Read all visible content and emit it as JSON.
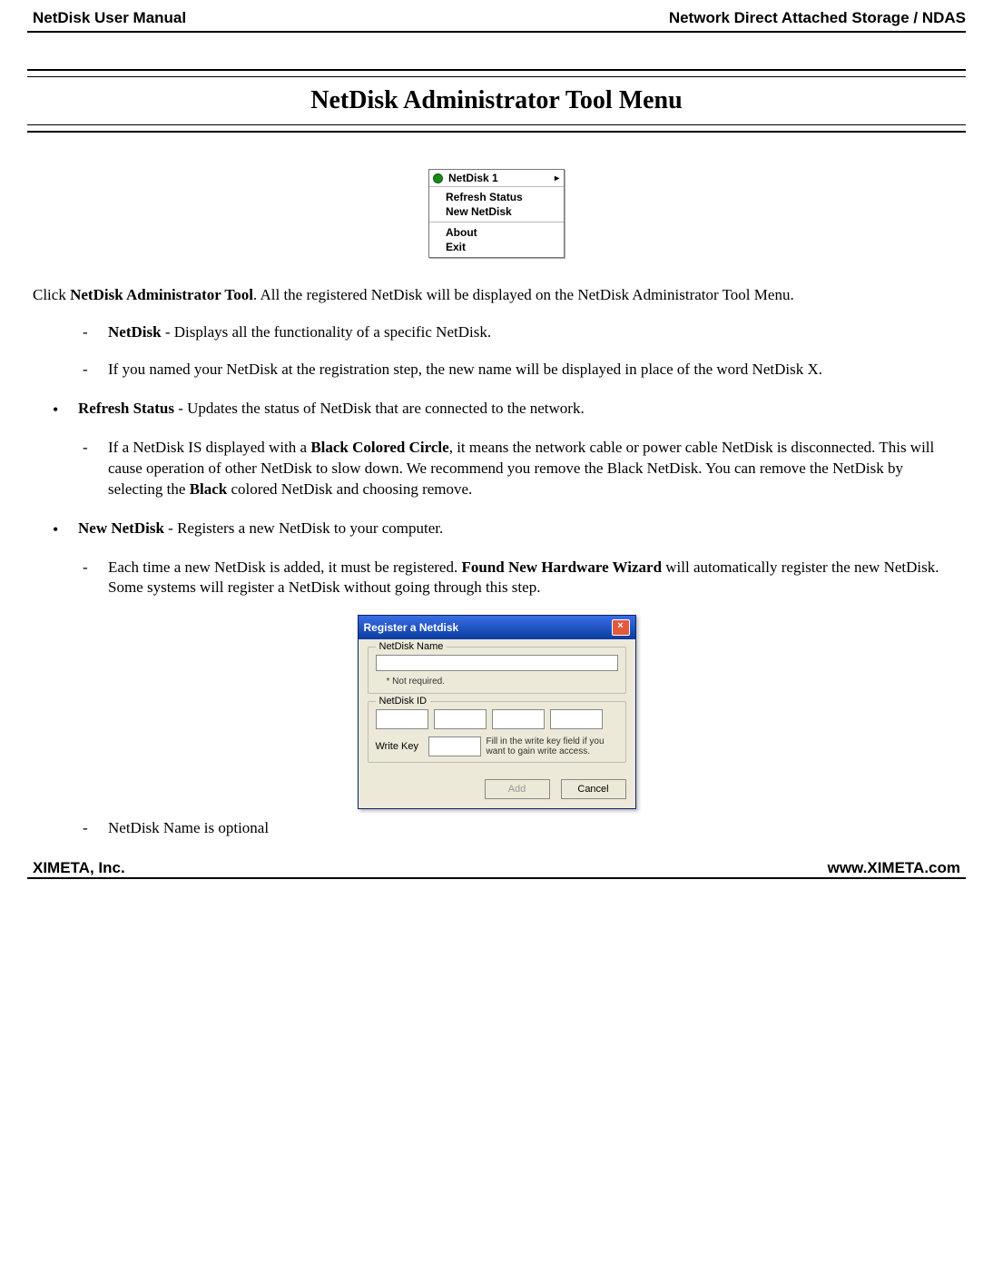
{
  "header": {
    "left": "NetDisk User Manual",
    "right": "Network Direct Attached Storage / NDAS"
  },
  "title": "NetDisk Administrator Tool Menu",
  "menu": {
    "device": "NetDisk 1",
    "items_a": [
      "Refresh Status",
      "New NetDisk"
    ],
    "items_b": [
      "About",
      "Exit"
    ]
  },
  "intro": {
    "pre": "Click ",
    "bold": "NetDisk Administrator Tool",
    "post": ".  All the registered NetDisk will be displayed on the NetDisk Administrator Tool Menu."
  },
  "netdisk_item": {
    "bold": "NetDisk",
    "text": " - Displays all the functionality of a specific NetDisk."
  },
  "rename_item": "If you named your NetDisk at the registration step, the new name will be displayed in place of the word NetDisk X.",
  "refresh": {
    "bold": "Refresh Status",
    "text": " - Updates the status of NetDisk that are connected to the network."
  },
  "black_circle": {
    "t1": "If a NetDisk IS displayed with a ",
    "b1": "Black Colored Circle",
    "t2": ", it means the network cable or power cable NetDisk is disconnected.  This will cause operation of other NetDisk to slow down.  We recommend you remove the Black NetDisk.  You can remove the NetDisk by selecting the ",
    "b2": "Black",
    "t3": " colored NetDisk and choosing remove."
  },
  "new_netdisk": {
    "bold": "New NetDisk",
    "text": " - Registers a new NetDisk to your computer."
  },
  "register_desc": {
    "t1": "Each time a new NetDisk is added, it must be registered.  ",
    "b1": "Found New Hardware Wizard",
    "t2": " will automatically register the new NetDisk.  Some systems will register a NetDisk without going through this step."
  },
  "dialog": {
    "title": "Register a Netdisk",
    "group_name": "NetDisk Name",
    "name_note": "* Not required.",
    "group_id": "NetDisk ID",
    "write_key_label": "Write Key",
    "write_key_note": "Fill in the write key field if you want to gain write access.",
    "btn_add": "Add",
    "btn_cancel": "Cancel"
  },
  "optional_note": "NetDisk Name is optional",
  "footer": {
    "left": "XIMETA, Inc.",
    "right": "www.XIMETA.com"
  }
}
